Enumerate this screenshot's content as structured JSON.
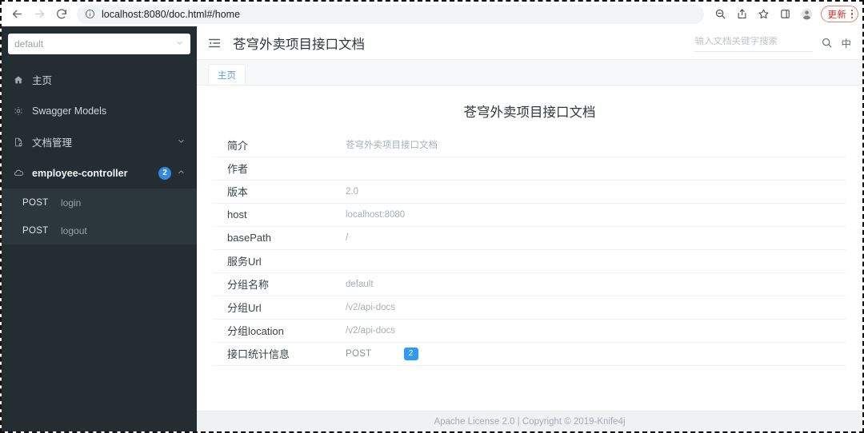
{
  "browser": {
    "url": "localhost:8080/doc.html#/home",
    "back_label": "Back",
    "forward_label": "Forward",
    "reload_label": "Reload",
    "info_icon": "info-circle-icon",
    "actions": [
      {
        "name": "zoom-out-icon",
        "label": "Zoom"
      },
      {
        "name": "share-icon",
        "label": "Share"
      },
      {
        "name": "bookmark-star-icon",
        "label": "Bookmark"
      },
      {
        "name": "side-panel-icon",
        "label": "Side panel"
      },
      {
        "name": "profile-icon",
        "label": "Profile"
      }
    ],
    "update_button": "更新",
    "menu_label": "Customize and control",
    "accent_update": "#d93025"
  },
  "sidebar": {
    "group_select": {
      "value": "default",
      "placeholder": "default"
    },
    "items": [
      {
        "label": "主页",
        "icon": "home-icon",
        "caret": ""
      },
      {
        "label": "Swagger Models",
        "icon": "gear-icon",
        "caret": ""
      },
      {
        "label": "文档管理",
        "icon": "document-icon",
        "caret": "⌄"
      },
      {
        "label": "employee-controller",
        "icon": "cloud-icon",
        "badge": "2",
        "caret": "⌃"
      }
    ],
    "api_rows": [
      {
        "verb": "POST",
        "path": "login"
      },
      {
        "verb": "POST",
        "path": "logout"
      }
    ],
    "badge_color": "#2f8ae0",
    "background": "#242e32"
  },
  "topbar": {
    "fold_icon": "menu-fold-icon",
    "title": "苍穹外卖项目接口文档",
    "search": {
      "placeholder": "输入文档关键字搜索",
      "value": ""
    },
    "search_icon": "search-icon",
    "lang_toggle": "中"
  },
  "tabs": [
    {
      "label": "主页",
      "active": true
    }
  ],
  "content": {
    "title": "苍穹外卖项目接口文档",
    "rows": [
      {
        "key": "简介",
        "value": "苍穹外卖项目接口文档"
      },
      {
        "key": "作者",
        "value": ""
      },
      {
        "key": "版本",
        "value": "2.0"
      },
      {
        "key": "host",
        "value": "localhost:8080"
      },
      {
        "key": "basePath",
        "value": "/"
      },
      {
        "key": "服务Url",
        "value": ""
      },
      {
        "key": "分组名称",
        "value": "default"
      },
      {
        "key": "分组Url",
        "value": "/v2/api-docs"
      },
      {
        "key": "分组location",
        "value": "/v2/api-docs"
      }
    ],
    "stats_row": {
      "key": "接口统计信息",
      "verb": "POST",
      "count": "2",
      "badge_color": "#2f9bf5"
    }
  },
  "footer": {
    "text": "Apache License 2.0 | Copyright © 2019-Knife4j"
  }
}
